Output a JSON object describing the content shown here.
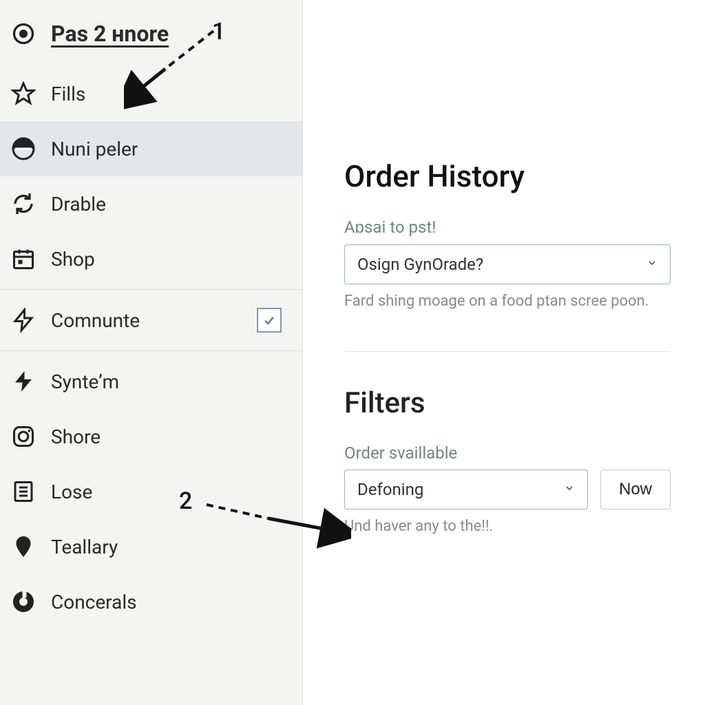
{
  "sidebar": {
    "title": "Pas 2 нnore",
    "items": [
      {
        "label": "Fills",
        "icon": "star-icon"
      },
      {
        "label": "Nuni peler",
        "icon": "circle-split-icon",
        "active": true
      },
      {
        "label": "Drable",
        "icon": "refresh-icon"
      },
      {
        "label": "Shop",
        "icon": "calendar-icon"
      },
      {
        "label": "Comnunte",
        "icon": "bolt-outline-icon",
        "checkbox": true,
        "checked": true
      },
      {
        "label": "Synteʼm",
        "icon": "bolt-icon"
      },
      {
        "label": "Shore",
        "icon": "camera-square-icon"
      },
      {
        "label": "Lose",
        "icon": "list-box-icon"
      },
      {
        "label": "Teallary",
        "icon": "pin-icon"
      },
      {
        "label": "Concerals",
        "icon": "donut-icon"
      }
    ]
  },
  "main": {
    "order_history": {
      "title": "Order History",
      "field_label": "Aɒsai to pst!",
      "select_value": "Osign GynOrade?",
      "help": "Fard shing moage on a food ptan scree poon."
    },
    "filters": {
      "title": "Filters",
      "field_label": "Order svaillable",
      "select_value": "Defoning",
      "help": "Und haver any to the!!.",
      "now_button": "Now"
    }
  },
  "annotations": {
    "one": "1",
    "two": "2"
  }
}
